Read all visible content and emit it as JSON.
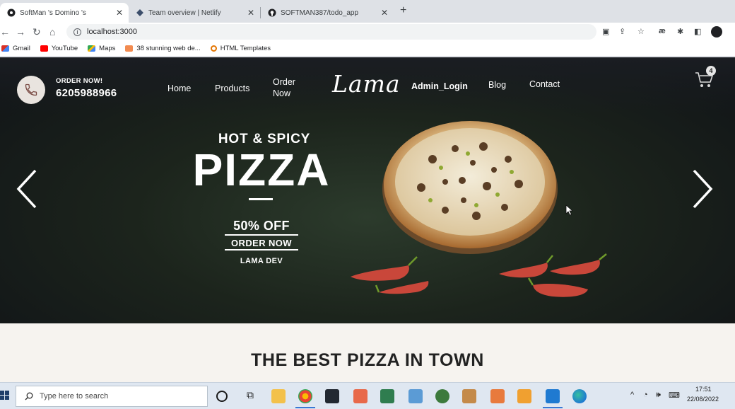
{
  "browser": {
    "tabs": [
      {
        "title": "SoftMan 's Domino 's",
        "icon": "site-icon",
        "active": true
      },
      {
        "title": "Team overview | Netlify",
        "icon": "netlify-icon",
        "active": false
      },
      {
        "title": "SOFTMAN387/todo_app",
        "icon": "github-icon",
        "active": false
      }
    ],
    "url": "localhost:3000",
    "bookmarks": [
      {
        "label": "Gmail",
        "icon": "gmail-icon",
        "color": "#d93025"
      },
      {
        "label": "YouTube",
        "icon": "youtube-icon",
        "color": "#ff0000"
      },
      {
        "label": "Maps",
        "icon": "maps-icon",
        "color": "#34a853"
      },
      {
        "label": "38 stunning web de...",
        "icon": "bookmark-icon",
        "color": "#f28b50"
      },
      {
        "label": "HTML Templates",
        "icon": "search-icon",
        "color": "#e37400"
      }
    ]
  },
  "site": {
    "order_label": "ORDER NOW!",
    "phone": "6205988966",
    "nav": {
      "home": "Home",
      "products": "Products",
      "order_line1": "Order",
      "order_line2": "Now",
      "logo": "Lama",
      "admin": "Admin_Login",
      "blog": "Blog",
      "contact": "Contact"
    },
    "cart_count": "4",
    "hero": {
      "kicker": "HOT & SPICY",
      "title": "PIZZA",
      "discount": "50% OFF",
      "cta": "ORDER NOW",
      "author": "LAMA DEV"
    },
    "section_title": "THE BEST PIZZA IN TOWN"
  },
  "taskbar": {
    "search_placeholder": "Type here to search",
    "time": "17:51",
    "date": "22/08/2022"
  },
  "colors": {
    "hero_dark": "#101317",
    "hero_green": "#2c3b2c",
    "section_bg": "#f6f3ef",
    "accent_blue": "#3b78d4"
  }
}
